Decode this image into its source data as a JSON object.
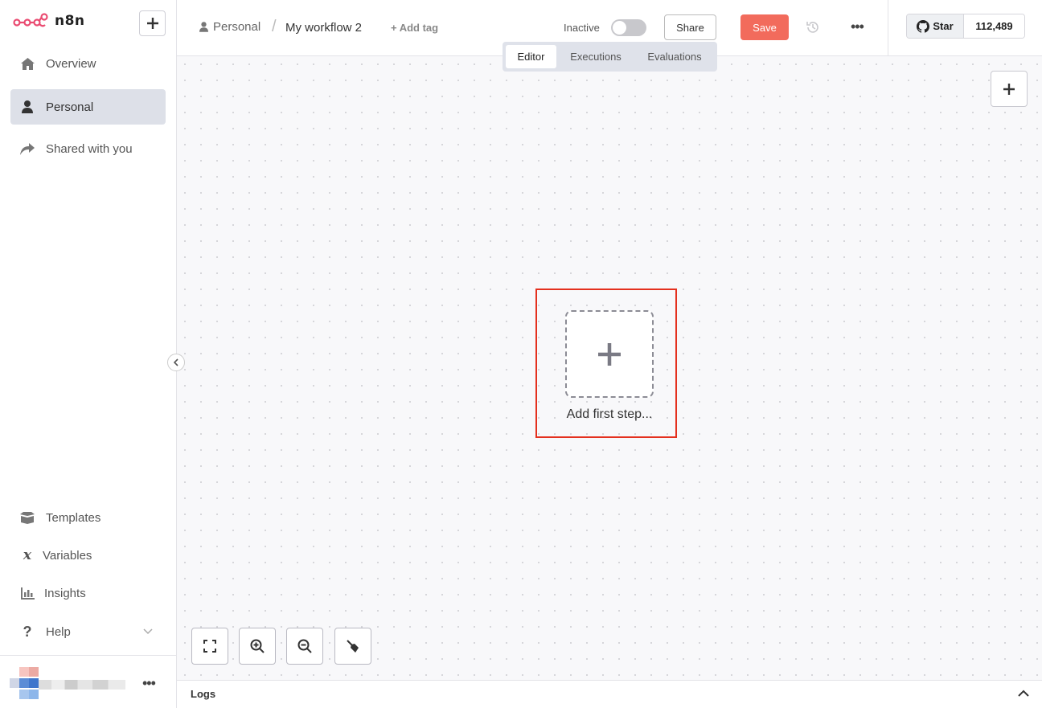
{
  "app": {
    "logo_text": "n8n",
    "brand_color": "#ea4b71",
    "accent_color": "#f26b5c"
  },
  "sidebar": {
    "new_icon": "plus-icon",
    "items": [
      {
        "label": "Overview",
        "icon": "home-icon"
      },
      {
        "label": "Personal",
        "icon": "user-icon",
        "active": true
      },
      {
        "label": "Shared with you",
        "icon": "share-icon"
      }
    ],
    "bottom_items": [
      {
        "label": "Templates",
        "icon": "box-icon"
      },
      {
        "label": "Variables",
        "icon": "variable-icon"
      },
      {
        "label": "Insights",
        "icon": "chart-icon"
      },
      {
        "label": "Help",
        "icon": "question-icon"
      }
    ],
    "user_more": "•••"
  },
  "header": {
    "breadcrumb": "Personal",
    "workflow_name": "My workflow 2",
    "add_tag": "+ Add tag",
    "status": "Inactive",
    "share": "Share",
    "save": "Save",
    "more": "•••",
    "github_star": "Star",
    "github_count": "112,489"
  },
  "tabs": [
    {
      "label": "Editor",
      "active": true
    },
    {
      "label": "Executions"
    },
    {
      "label": "Evaluations"
    }
  ],
  "canvas": {
    "add_first_step": "Add first step..."
  },
  "logs": {
    "label": "Logs"
  }
}
